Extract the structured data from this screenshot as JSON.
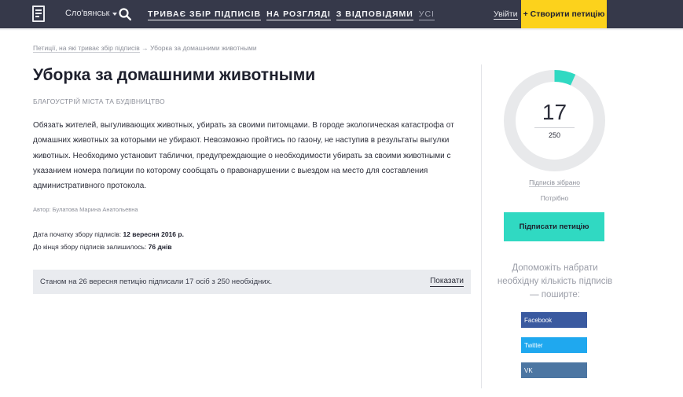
{
  "header": {
    "city": "Сло'вянськ",
    "nav": [
      "ТРИВАЄ ЗБІР ПІДПИСІВ",
      "НА РОЗГЛЯДІ",
      "З ВІДПОВІДЯМИ",
      "УСІ"
    ],
    "login": "Увійти",
    "create": "+ Створити петицію"
  },
  "breadcrumb": {
    "link": "Петиції, на які триває збір підписів",
    "current": "→ Уборка за домашними животными"
  },
  "petition": {
    "title": "Уборка за домашними животными",
    "category": "БЛАГОУСТРІЙ МІСТА ТА БУДІВНИЦТВО",
    "text": "Обязать жителей, выгуливающих животных, убирать за своими питомцами. В городе экологическая катастрофа от домашних животных за которыми не убирают. Невозможно пройтись по газону, не наступив в результаты выгулки животных. Необходимо установит таблички, предупреждающие о необходимости убирать за своими животными с указанием номера полиции по которому сообщать о правонарушении с выездом на место для составления административного протокола.",
    "author": "Автор: Булатова Марина Анатольевна",
    "start_label": "Дата початку збору підписів:",
    "start_value": "12 вересня 2016 р.",
    "left_label": "До кінця збору підписів залишилось:",
    "left_value": "76 днів",
    "status_text": "Станом на 26 вересня петицію підписали 17 осіб з 250 необхідних.",
    "status_link": "Показати"
  },
  "sidebar": {
    "signed": "17",
    "goal": "250",
    "progress": 0.068,
    "collected_label": "Підписів зібрано",
    "needed_label": "Потрібно",
    "sign_button": "Підписати петицію",
    "share_text": "Допоможіть набрати необхідну кількість підписів — поширте:",
    "social": [
      "Facebook",
      "Twitter",
      "VK"
    ]
  },
  "colors": {
    "header_bg": "#36394a",
    "accent_yellow": "#fcd21c",
    "accent_teal": "#30d9c2",
    "facebook": "#3a5aa0",
    "twitter": "#1fa8ef",
    "vk": "#4c76a2"
  }
}
